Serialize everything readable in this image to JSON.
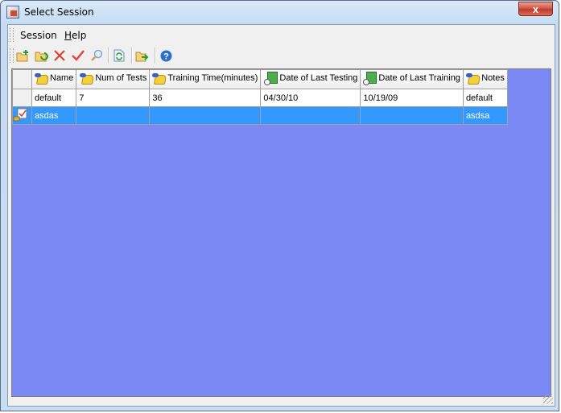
{
  "window": {
    "title": "Select Session",
    "close_label": "x"
  },
  "menu": {
    "items": [
      {
        "label": "Session"
      },
      {
        "label": "Help"
      }
    ]
  },
  "toolbar": {
    "buttons": [
      {
        "icon": "new-folder-icon"
      },
      {
        "icon": "open-folder-icon"
      },
      {
        "icon": "delete-icon"
      },
      {
        "icon": "check-icon"
      },
      {
        "icon": "search-icon"
      },
      {
        "icon": "refresh-icon"
      },
      {
        "icon": "export-icon"
      },
      {
        "icon": "help-icon"
      }
    ]
  },
  "table": {
    "columns": [
      {
        "label": "Name",
        "icon": "key-icon"
      },
      {
        "label": "Num of Tests",
        "icon": "key-icon"
      },
      {
        "label": "Training Time(minutes)",
        "icon": "key-icon"
      },
      {
        "label": "Date of Last Testing",
        "icon": "date-icon"
      },
      {
        "label": "Date of Last Training",
        "icon": "date-icon"
      },
      {
        "label": "Notes",
        "icon": "key-icon"
      }
    ],
    "rows": [
      {
        "cells": [
          "default",
          "7",
          "36",
          "04/30/10",
          "10/19/09",
          "default"
        ],
        "selected": false
      },
      {
        "cells": [
          "asdas",
          "",
          "",
          "",
          "",
          "asdsa"
        ],
        "selected": true
      }
    ]
  },
  "colors": {
    "grid_background": "#7b89f4",
    "selection": "#3399ff"
  }
}
